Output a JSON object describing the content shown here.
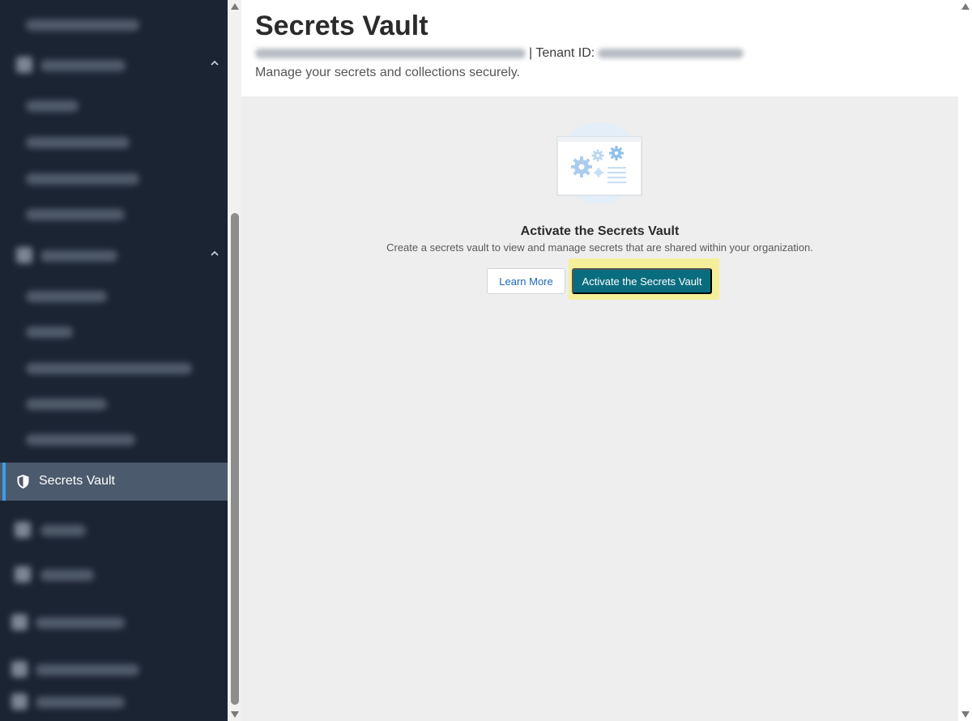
{
  "sidebar": {
    "active_item": {
      "label": "Secrets Vault",
      "icon": "shield-icon"
    },
    "colors": {
      "background": "#1b2433",
      "active_bg": "#4b5a6c",
      "active_indicator": "#3b9ee8"
    }
  },
  "header": {
    "title": "Secrets Vault",
    "tenant_label": "| Tenant ID:",
    "subtitle": "Manage your secrets and collections securely."
  },
  "empty_state": {
    "illustration": "gears-document-illustration",
    "title": "Activate the Secrets Vault",
    "description": "Create a secrets vault to view and manage secrets that are shared within your organization.",
    "learn_more_label": "Learn More",
    "activate_label": "Activate the Secrets Vault"
  },
  "colors": {
    "primary_button": "#0a6d7f",
    "link": "#1d67b8",
    "highlight": "#f5ef9a",
    "content_bg": "#eeeeee"
  }
}
